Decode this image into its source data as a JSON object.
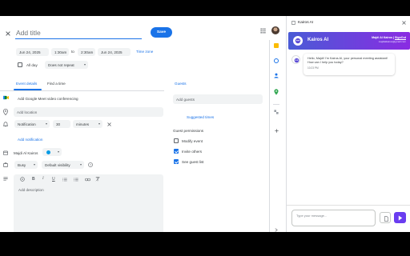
{
  "event": {
    "title_placeholder": "Add title",
    "save_label": "Save",
    "start_date": "Jun 24, 2025",
    "start_time": "1:30am",
    "to_label": "to",
    "end_time": "2:30am",
    "end_date": "Jun 24, 2025",
    "time_zone_label": "Time zone",
    "all_day_label": "All day",
    "repeat_value": "Does not repeat",
    "tab_details": "Event details",
    "tab_find_time": "Find a time",
    "meet_label": "Add Google Meet video conferencing",
    "location_placeholder": "Add location",
    "notification_type": "Notification",
    "notification_amount": "30",
    "notification_unit": "minutes",
    "add_notification_label": "Add notification",
    "calendar_owner": "Majdi Al Kairos",
    "calendar_color": "#039be5",
    "busy_value": "Busy",
    "visibility_value": "Default visibility",
    "description_placeholder": "Add description"
  },
  "guests": {
    "header": "Guests",
    "add_placeholder": "Add guests",
    "suggested_times": "Suggested times",
    "permissions_header": "Guest permissions",
    "permissions": [
      {
        "label": "Modify event",
        "checked": false
      },
      {
        "label": "Invite others",
        "checked": true
      },
      {
        "label": "See guest list",
        "checked": true
      }
    ]
  },
  "assistant": {
    "window_title": "Kairos AI",
    "header_title": "Kairos AI",
    "user_name": "Majdi Al Kairos",
    "signout_label": "SignOut",
    "user_email": "majdialkairos@gmail.com",
    "message": "Hello, Majdi! I'm Kairos AI, your personal meeting assistant! How can I help you today?",
    "message_time": "10:23 PM",
    "input_placeholder": "Type your message...",
    "colors": {
      "header_gradient_start": "#4a5bd6",
      "header_gradient_end": "#8a2be2",
      "send_button": "#6a3df0"
    }
  },
  "colors": {
    "accent": "#1a73e8",
    "surface": "#f1f3f4"
  }
}
